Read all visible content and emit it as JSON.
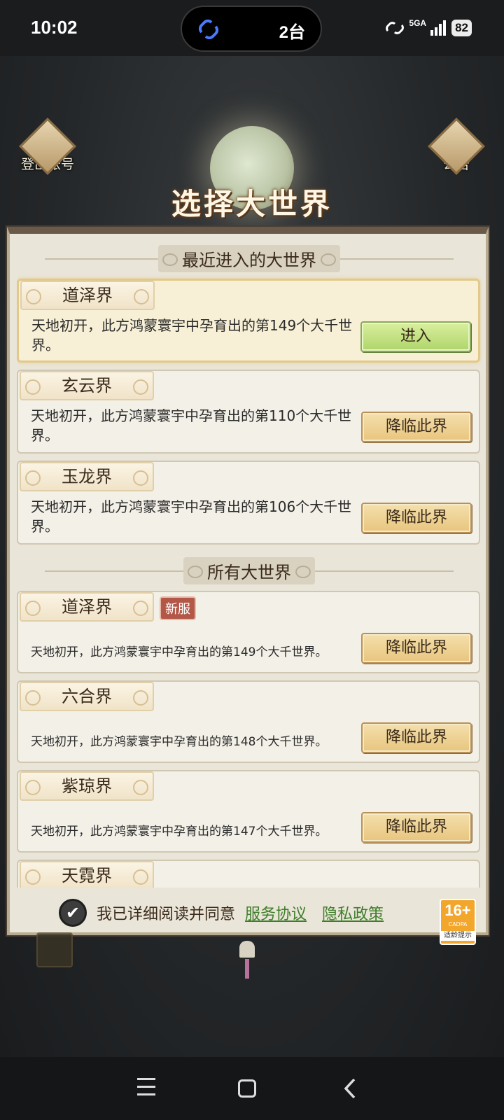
{
  "status_bar": {
    "time": "10:02",
    "device_count": "2台",
    "network": "5GA",
    "battery": "82"
  },
  "header": {
    "logout_label": "登出账号",
    "notice_label": "公告",
    "title": "选择大世界"
  },
  "recent_section": {
    "title": "最近进入的大世界",
    "servers": [
      {
        "name": "道泽界",
        "description": "天地初开，此方鸿蒙寰宇中孕育出的第149个大千世界。",
        "button": "进入"
      },
      {
        "name": "玄云界",
        "description": "天地初开，此方鸿蒙寰宇中孕育出的第110个大千世界。",
        "button": "降临此界"
      },
      {
        "name": "玉龙界",
        "description": "天地初开，此方鸿蒙寰宇中孕育出的第106个大千世界。",
        "button": "降临此界"
      }
    ]
  },
  "all_section": {
    "title": "所有大世界",
    "servers": [
      {
        "name": "道泽界",
        "badge": "新服",
        "description": "天地初开，此方鸿蒙寰宇中孕育出的第149个大千世界。",
        "button": "降临此界"
      },
      {
        "name": "六合界",
        "description": "天地初开，此方鸿蒙寰宇中孕育出的第148个大千世界。",
        "button": "降临此界"
      },
      {
        "name": "紫琼界",
        "description": "天地初开，此方鸿蒙寰宇中孕育出的第147个大千世界。",
        "button": "降临此界"
      },
      {
        "name": "天霓界"
      }
    ]
  },
  "agreement": {
    "checked": true,
    "text": "我已详细阅读并同意",
    "service_link": "服务协议",
    "privacy_link": "隐私政策"
  },
  "age_rating": {
    "value": "16+",
    "org": "CADPA",
    "label": "适龄提示"
  },
  "colors": {
    "enter_button": "#aed56a",
    "descend_button": "#e8c57e",
    "link": "#3e7d2a",
    "new_badge": "#b35848"
  }
}
